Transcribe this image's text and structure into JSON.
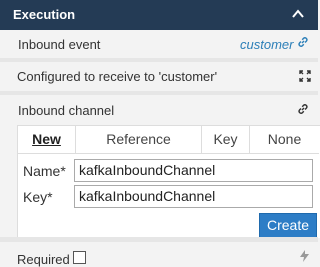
{
  "header": {
    "title": "Execution",
    "toggle_icon": "chevron-up-icon"
  },
  "inbound_event": {
    "label": "Inbound event",
    "value": "customer",
    "icon": "link-icon"
  },
  "configured": {
    "text": "Configured to receive to 'customer'",
    "icon": "expand-icon"
  },
  "inbound_channel": {
    "label": "Inbound channel",
    "icon": "link-icon",
    "tabs": [
      {
        "label": "New",
        "active": true
      },
      {
        "label": "Reference",
        "active": false
      },
      {
        "label": "Key",
        "active": false
      },
      {
        "label": "None",
        "active": false
      }
    ],
    "name_label": "Name*",
    "name_value": "kafkaInboundChannel",
    "key_label": "Key*",
    "key_value": "kafkaInboundChannel",
    "create_label": "Create"
  },
  "required": {
    "label": "Required",
    "checked": false,
    "icon": "bolt-icon"
  },
  "colors": {
    "header_bg": "#243b55",
    "accent": "#2d7dc6",
    "link": "#2c7fb8"
  }
}
